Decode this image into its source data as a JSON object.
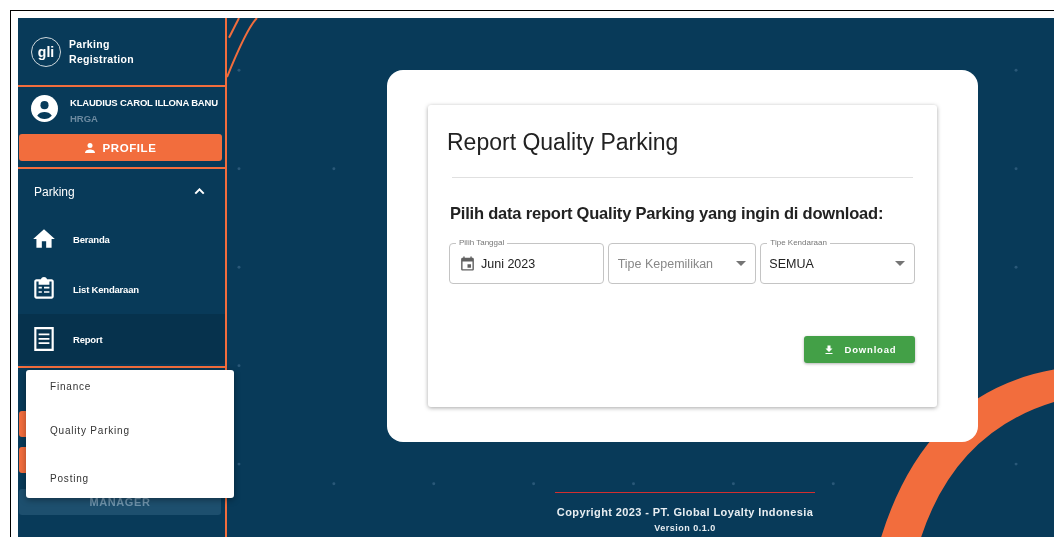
{
  "sidebar": {
    "logo": "gli",
    "app_name": "Parking Registration",
    "user": {
      "name": "KLAUDIUS CAROL ILLONA BANU",
      "role": "HRGA"
    },
    "profile_button": "PROFILE",
    "section": {
      "label": "Parking",
      "expanded": true
    },
    "items": [
      {
        "label": "Beranda",
        "kind": "home",
        "selected": false
      },
      {
        "label": "List Kendaraan",
        "kind": "list",
        "selected": false
      },
      {
        "label": "Report",
        "kind": "report",
        "selected": true
      }
    ],
    "covered_buttons": [
      {
        "kind": "orange"
      },
      {
        "kind": "orange"
      }
    ],
    "manager_button": {
      "label": "MANAGER",
      "disabled": true
    }
  },
  "report_menu": [
    {
      "label": "Finance"
    },
    {
      "label": "Quality Parking"
    },
    {
      "label": "Posting"
    }
  ],
  "card": {
    "title": "Report Quality Parking",
    "subtitle": "Pilih data report Quality Parking yang ingin di download:",
    "fields": [
      {
        "kind": "date",
        "label": "Pilih Tanggal",
        "value": "Juni 2023"
      },
      {
        "kind": "select",
        "placeholder": "Tipe Kepemilikan"
      },
      {
        "kind": "select",
        "label": "Tipe Kendaraan",
        "value": "SEMUA"
      }
    ],
    "download_button": "Download"
  },
  "footer": {
    "copyright": "Copyright 2023 - PT. Global Loyalty Indonesia",
    "version": "Version 0.1.0"
  }
}
